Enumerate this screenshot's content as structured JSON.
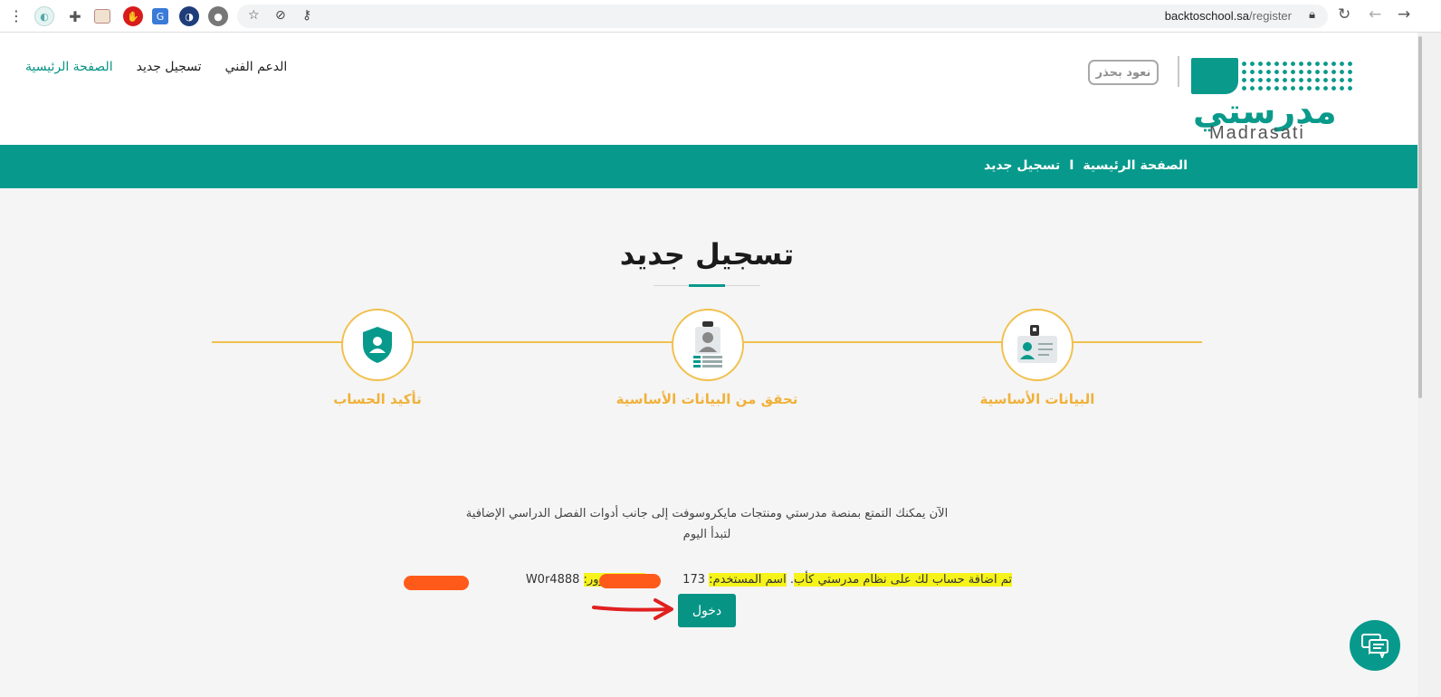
{
  "browser": {
    "url_host": "backtoschool.sa",
    "url_path": "/register"
  },
  "header": {
    "nav": [
      {
        "label": "الصفحة الرئيسية",
        "active": true
      },
      {
        "label": "تسجيل جديد",
        "active": false
      },
      {
        "label": "الدعم الفني",
        "active": false
      }
    ],
    "badge_text": "نعود بحذر",
    "logo_ar": "مدرستي",
    "logo_en": "Madrasati"
  },
  "breadcrumb": {
    "home": "الصفحة الرئيسية",
    "separator": "I",
    "current": "تسجيل جديد"
  },
  "main": {
    "title": "تسجيل جديد",
    "steps": [
      {
        "label": "البيانات الأساسية",
        "icon": "id-card-icon"
      },
      {
        "label": "تحقق من البيانات الأساسية",
        "icon": "id-badge-icon"
      },
      {
        "label": "تأكيد الحساب",
        "icon": "shield-user-icon"
      }
    ],
    "message_line1": "الآن يمكنك التمتع بمنصة مدرستي ومنتجات مايكروسوفت إلى جانب أدوات الفصل الدراسي الإضافية",
    "message_line2": "لتبدأ اليوم",
    "credentials": {
      "added_text": "تم اضافة حساب لك على نظام مدرستي كأب",
      "username_label": "اسم المستخدم:",
      "username_value": "173",
      "password_label": "كلمة المرور:",
      "password_value": "W0r4888"
    },
    "login_button": "دخول"
  },
  "colors": {
    "primary": "#079a8c",
    "step_accent": "#f1c04c",
    "step_label": "#f0b13a",
    "highlight": "#f6f31a"
  }
}
